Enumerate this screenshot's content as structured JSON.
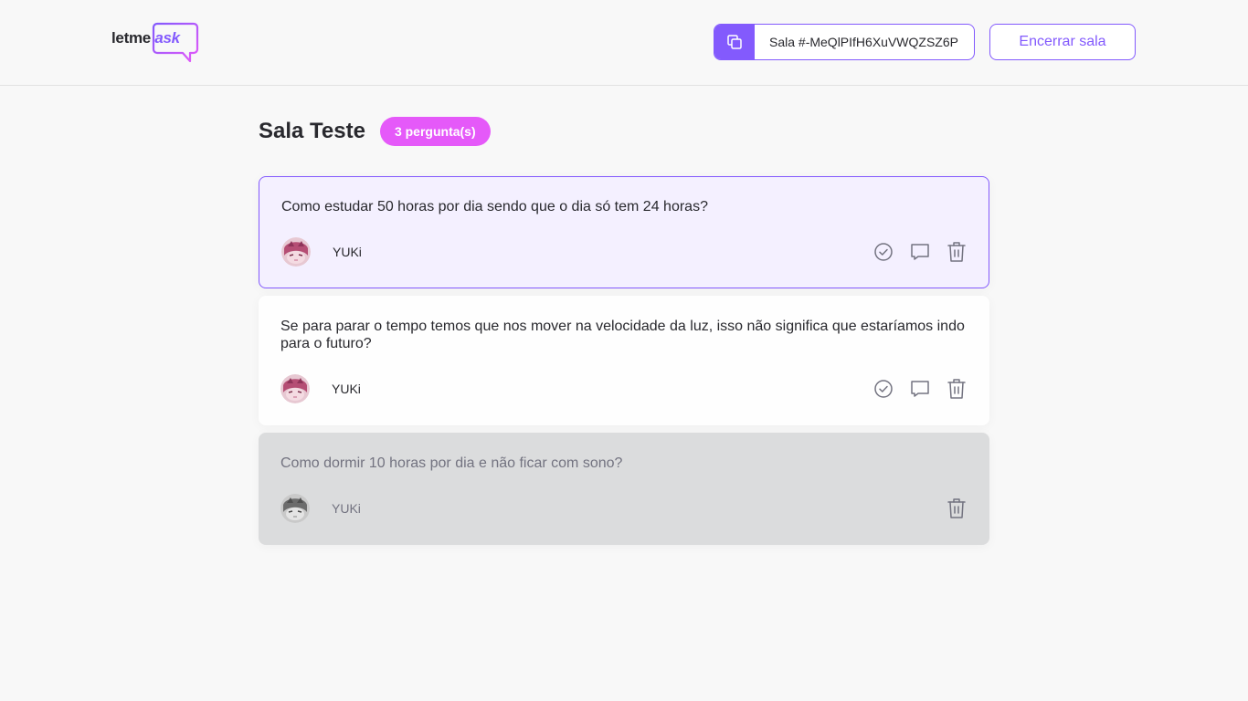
{
  "header": {
    "logo": {
      "part1": "letme",
      "part2": "ask"
    },
    "room_code": {
      "label": "Sala #-MeQlPIfH6XuVWQZSZ6P",
      "icon": "copy-icon"
    },
    "end_room_label": "Encerrar sala"
  },
  "room": {
    "title": "Sala Teste",
    "badge": "3 pergunta(s)"
  },
  "questions": [
    {
      "content": "Como estudar 50 horas por dia sendo que o dia só tem 24 horas?",
      "author": "YUKi",
      "state": "highlighted",
      "actions": [
        "check-icon",
        "chat-icon",
        "trash-icon"
      ]
    },
    {
      "content": "Se para parar o tempo temos que nos mover na velocidade da luz, isso não significa que estaríamos indo para o futuro?",
      "author": "YUKi",
      "state": "normal",
      "actions": [
        "check-icon",
        "chat-icon",
        "trash-icon"
      ]
    },
    {
      "content": "Como dormir 10 horas por dia e não ficar com sono?",
      "author": "YUKi",
      "state": "answered",
      "actions": [
        "trash-icon"
      ]
    }
  ],
  "colors": {
    "primary": "#835afd",
    "pink": "#e559f9",
    "highlight_bg": "#f4f0ff",
    "answered_bg": "#dbdcdd",
    "icon_gray": "#737380"
  }
}
